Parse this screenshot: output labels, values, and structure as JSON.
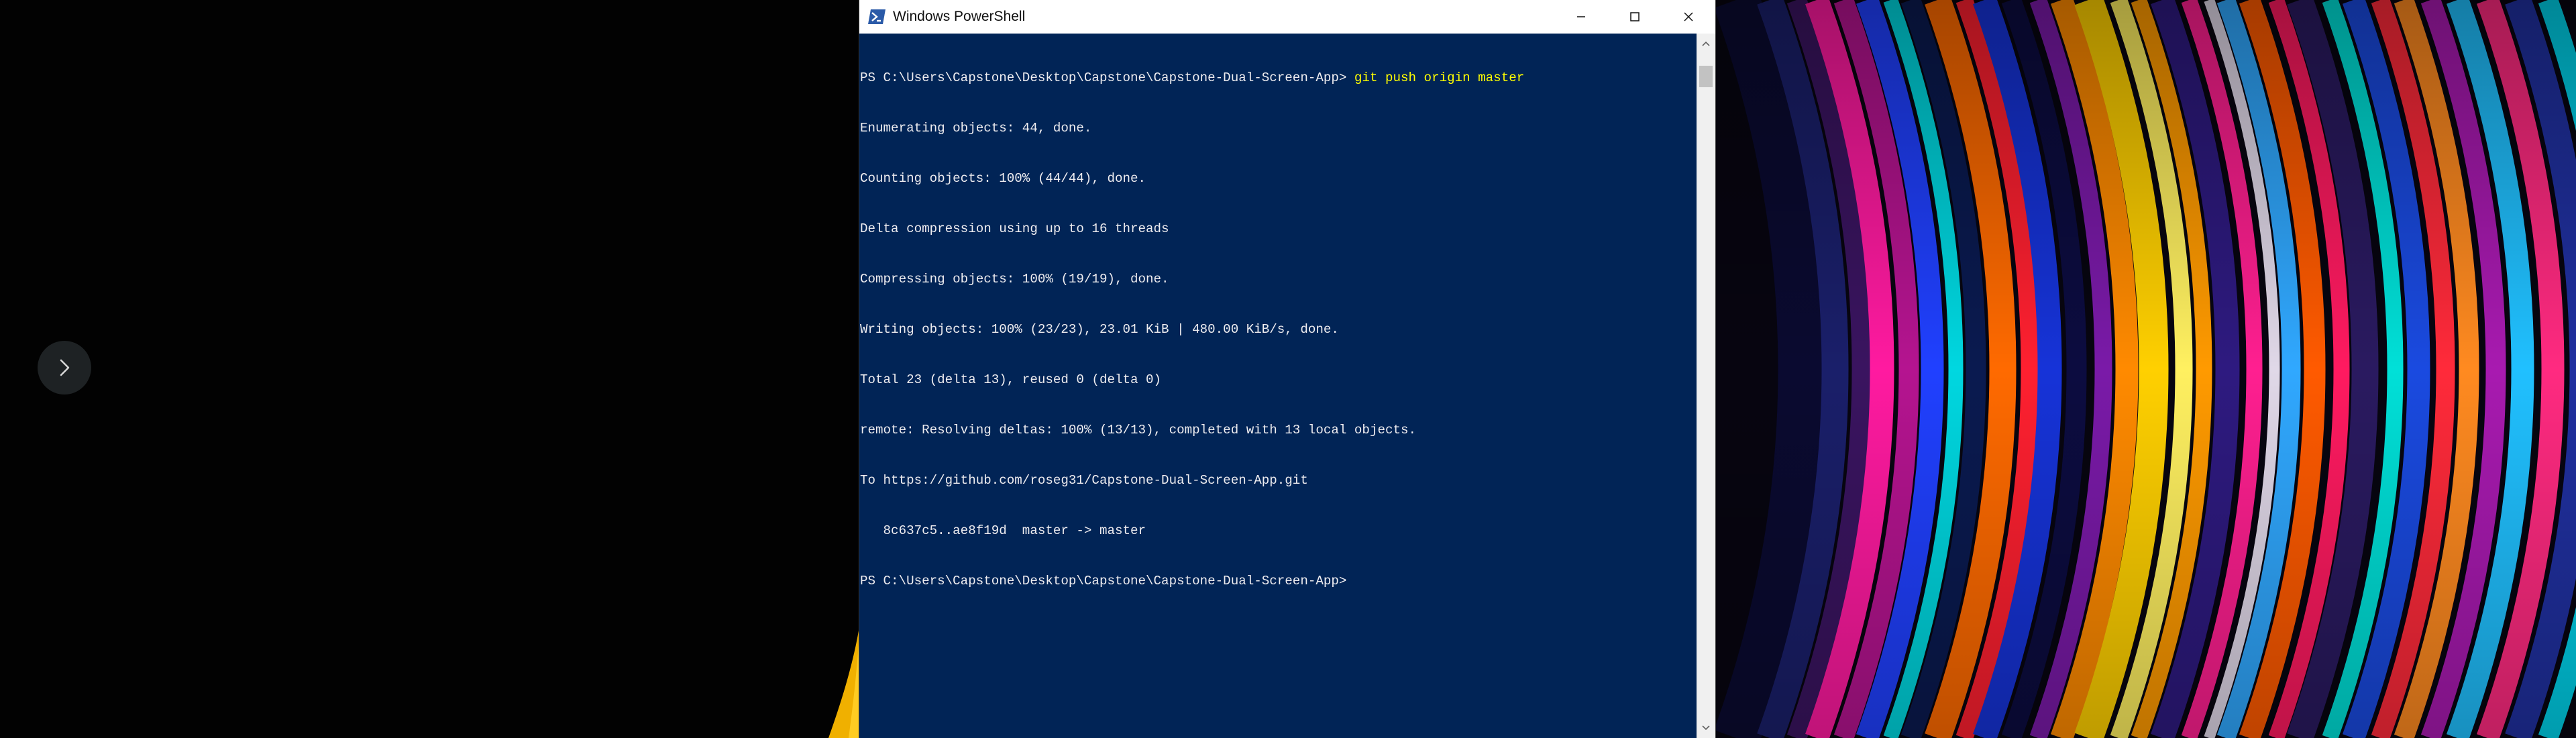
{
  "window": {
    "title": "Windows PowerShell",
    "icon": "powershell-icon",
    "controls": {
      "minimize": "minimize-icon",
      "maximize": "maximize-icon",
      "close": "close-icon"
    }
  },
  "console": {
    "prompt": "PS C:\\Users\\Capstone\\Desktop\\Capstone\\Capstone-Dual-Screen-App>",
    "command": "git push origin master",
    "output": [
      "Enumerating objects: 44, done.",
      "Counting objects: 100% (44/44), done.",
      "Delta compression using up to 16 threads",
      "Compressing objects: 100% (19/19), done.",
      "Writing objects: 100% (23/23), 23.01 KiB | 480.00 KiB/s, done.",
      "Total 23 (delta 13), reused 0 (delta 0)",
      "remote: Resolving deltas: 100% (13/13), completed with 13 local objects.",
      "To https://github.com/roseg31/Capstone-Dual-Screen-App.git",
      "   8c637c5..ae8f19d  master -> master"
    ],
    "final_prompt": "PS C:\\Users\\Capstone\\Desktop\\Capstone\\Capstone-Dual-Screen-App>"
  },
  "colors": {
    "console_background": "#012456",
    "console_text": "#eeedf0",
    "command_text": "#ffff00",
    "titlebar": "#ffffff"
  },
  "left_nav": {
    "icon": "chevron-right-icon"
  }
}
